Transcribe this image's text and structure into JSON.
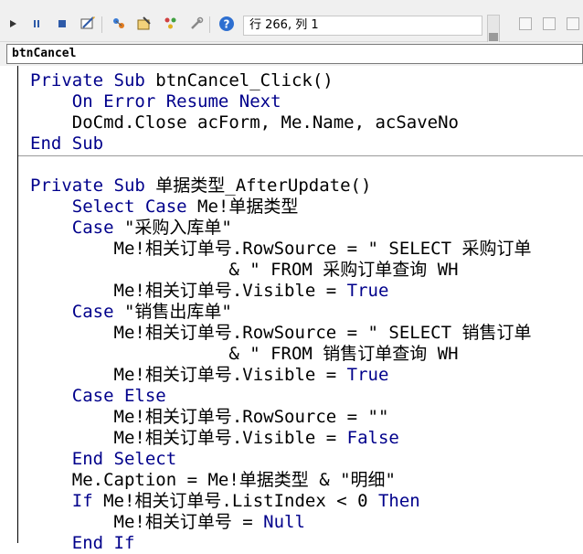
{
  "toolbar": {
    "status": "行 266, 列 1",
    "icons": [
      "run-icon",
      "break-icon",
      "reset-icon",
      "design-mode-icon",
      "project-explorer-icon",
      "properties-icon",
      "object-browser-icon",
      "toolbox-icon",
      "help-icon"
    ]
  },
  "procedure": {
    "name": "btnCancel"
  },
  "code": {
    "lines": [
      [
        {
          "t": "Private Sub ",
          "k": 1
        },
        {
          "t": "btnCancel_Click()",
          "k": 0
        }
      ],
      [
        {
          "t": "    On Error Resume Next",
          "k": 1
        }
      ],
      [
        {
          "t": "    DoCmd.Close acForm, Me.Name, acSaveNo",
          "k": 0
        }
      ],
      [
        {
          "t": "End Sub",
          "k": 1
        }
      ],
      [],
      [
        {
          "t": "Private Sub ",
          "k": 1
        },
        {
          "t": "单据类型_AfterUpdate()",
          "k": 0
        }
      ],
      [
        {
          "t": "    Select Case ",
          "k": 1
        },
        {
          "t": "Me!单据类型",
          "k": 0
        }
      ],
      [
        {
          "t": "    Case ",
          "k": 1
        },
        {
          "t": "\"采购入库单\"",
          "k": 0
        }
      ],
      [
        {
          "t": "        Me!相关订单号.RowSource = \" SELECT 采购订单",
          "k": 0
        }
      ],
      [
        {
          "t": "                   & \" FROM 采购订单查询 WH",
          "k": 0
        }
      ],
      [
        {
          "t": "        Me!相关订单号.Visible = ",
          "k": 0
        },
        {
          "t": "True",
          "k": 1
        }
      ],
      [
        {
          "t": "    Case ",
          "k": 1
        },
        {
          "t": "\"销售出库单\"",
          "k": 0
        }
      ],
      [
        {
          "t": "        Me!相关订单号.RowSource = \" SELECT 销售订单",
          "k": 0
        }
      ],
      [
        {
          "t": "                   & \" FROM 销售订单查询 WH",
          "k": 0
        }
      ],
      [
        {
          "t": "        Me!相关订单号.Visible = ",
          "k": 0
        },
        {
          "t": "True",
          "k": 1
        }
      ],
      [
        {
          "t": "    Case Else",
          "k": 1
        }
      ],
      [
        {
          "t": "        Me!相关订单号.RowSource = \"\"",
          "k": 0
        }
      ],
      [
        {
          "t": "        Me!相关订单号.Visible = ",
          "k": 0
        },
        {
          "t": "False",
          "k": 1
        }
      ],
      [
        {
          "t": "    End Select",
          "k": 1
        }
      ],
      [
        {
          "t": "    Me.Caption = Me!单据类型 & \"明细\"",
          "k": 0
        }
      ],
      [
        {
          "t": "    If ",
          "k": 1
        },
        {
          "t": "Me!相关订单号.ListIndex < 0 ",
          "k": 0
        },
        {
          "t": "Then",
          "k": 1
        }
      ],
      [
        {
          "t": "        Me!相关订单号 = ",
          "k": 0
        },
        {
          "t": "Null",
          "k": 1
        }
      ],
      [
        {
          "t": "    End If",
          "k": 1
        }
      ]
    ]
  },
  "colors": {
    "keyword": "#00008b",
    "text": "#000000"
  }
}
